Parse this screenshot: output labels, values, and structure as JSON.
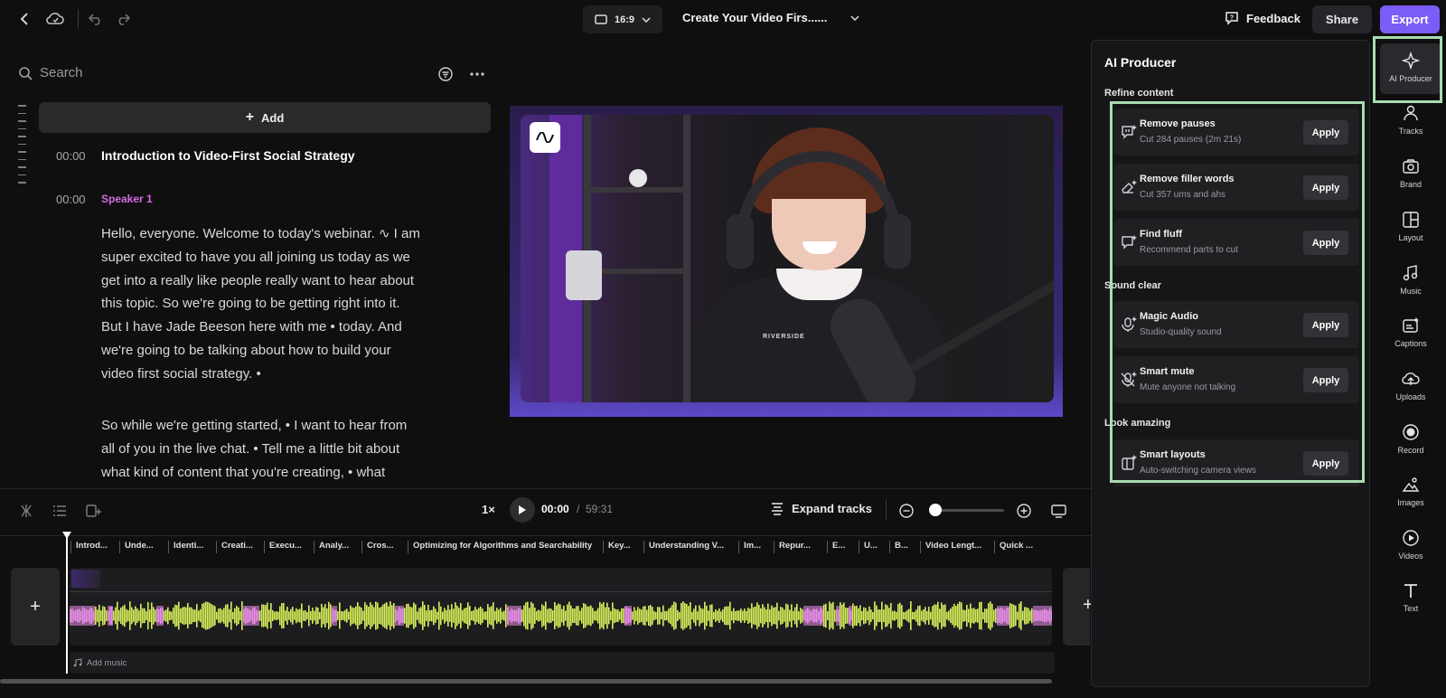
{
  "topbar": {
    "ratio": "16:9",
    "project_title": "Create Your Video Firs......",
    "feedback": "Feedback",
    "share": "Share",
    "export": "Export"
  },
  "transcript": {
    "search_placeholder": "Search",
    "add_label": "Add",
    "chapter_time": "00:00",
    "chapter_title": "Introduction to Video-First Social Strategy",
    "speaker_time": "00:00",
    "speaker": "Speaker 1",
    "lines_p1": [
      "Hello, everyone. Welcome to today's webinar. ∿ I am",
      "super excited to have you all joining us today as we",
      "get into a really like people really want to hear about",
      "this topic. So we're going to be getting right into it.",
      "But I have Jade Beeson here with me • today. And",
      "we're going to be talking about how to build your",
      "video first social strategy. •"
    ],
    "lines_p2": [
      "So while we're getting started, • I want to hear from",
      "all of you in the live chat. • Tell me a little bit about",
      "what kind of content that you're creating, • what"
    ]
  },
  "preview": {
    "shirt_text": "RIVERSIDE"
  },
  "playback": {
    "rate": "1×",
    "current": "00:00",
    "separator": "/",
    "total": "59:31",
    "expand_label": "Expand tracks",
    "zoom_level": 0.05
  },
  "timeline": {
    "chapters": [
      "Introd...",
      "Unde...",
      "Identi...",
      "Creati...",
      "Execu...",
      "Analy...",
      "Cros...",
      "Optimizing for Algorithms and Searchability",
      "Key...",
      "Understanding V...",
      "Im...",
      "Repur...",
      "E...",
      "U...",
      "B...",
      "Video Lengt...",
      "Quick ..."
    ],
    "add_music": "Add music",
    "colors": {
      "speech": "#d7f05a",
      "pause": "#e78ee6"
    }
  },
  "ai_panel": {
    "title": "AI Producer",
    "sections": [
      {
        "heading": "Refine content",
        "items": [
          {
            "title": "Remove pauses",
            "subtitle": "Cut 284 pauses (2m 21s)",
            "action": "Apply",
            "icon": "pause-bubble-icon"
          },
          {
            "title": "Remove filler words",
            "subtitle": "Cut 357 ums and ahs",
            "action": "Apply",
            "icon": "eraser-icon"
          },
          {
            "title": "Find fluff",
            "subtitle": "Recommend parts to cut",
            "action": "Apply",
            "icon": "sparkle-bubble-icon"
          }
        ]
      },
      {
        "heading": "Sound clear",
        "items": [
          {
            "title": "Magic Audio",
            "subtitle": "Studio-quality sound",
            "action": "Apply",
            "icon": "magic-mic-icon"
          },
          {
            "title": "Smart mute",
            "subtitle": "Mute anyone not talking",
            "action": "Apply",
            "icon": "mute-mic-icon"
          }
        ]
      },
      {
        "heading": "Look amazing",
        "items": [
          {
            "title": "Smart layouts",
            "subtitle": "Auto-switching camera views",
            "action": "Apply",
            "icon": "layout-sparkle-icon"
          }
        ]
      }
    ]
  },
  "rail": [
    {
      "label": "AI Producer",
      "icon": "sparkle-icon",
      "active": true
    },
    {
      "label": "Tracks",
      "icon": "people-icon"
    },
    {
      "label": "Brand",
      "icon": "brand-icon"
    },
    {
      "label": "Layout",
      "icon": "layout-icon"
    },
    {
      "label": "Music",
      "icon": "music-note-icon"
    },
    {
      "label": "Captions",
      "icon": "captions-icon"
    },
    {
      "label": "Uploads",
      "icon": "upload-cloud-icon"
    },
    {
      "label": "Record",
      "icon": "record-icon"
    },
    {
      "label": "Images",
      "icon": "image-icon"
    },
    {
      "label": "Videos",
      "icon": "video-play-icon"
    },
    {
      "label": "Text",
      "icon": "text-t-icon"
    }
  ]
}
